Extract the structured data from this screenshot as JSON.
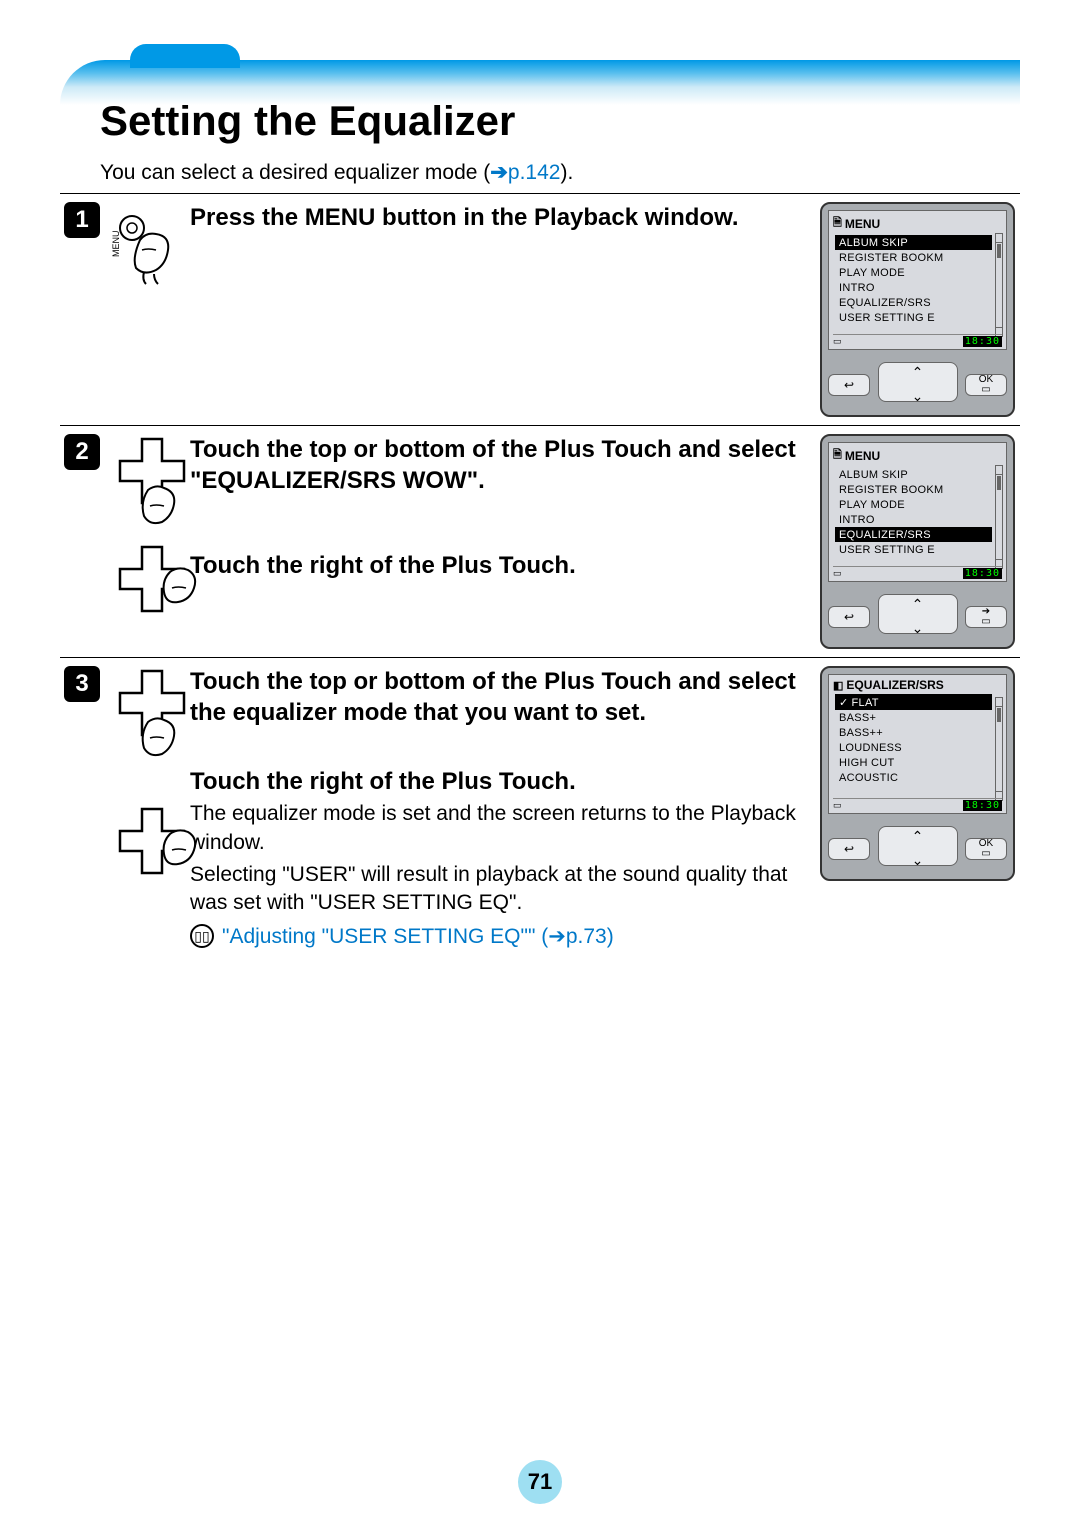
{
  "title": "Setting the Equalizer",
  "intro_text": "You can select a desired equalizer mode (",
  "intro_link_arrow": "➔",
  "intro_link_page": "p.142",
  "intro_close": ").",
  "steps": [
    {
      "num": "1",
      "instruction": "Press the MENU button in the Playback window."
    },
    {
      "num": "2",
      "instruction": "Touch the top or bottom of the Plus Touch and select \"EQUALIZER/SRS WOW\".",
      "sub": "Touch the right of the Plus Touch."
    },
    {
      "num": "3",
      "instruction": "Touch the top or bottom of the Plus Touch and select the equalizer mode that you want to set.",
      "sub": "Touch the right of the Plus Touch.",
      "body1": "The equalizer mode is set and the screen returns to the Playback window.",
      "body2": "Selecting \"USER\" will result in playback at the sound quality that was set with \"USER SETTING EQ\".",
      "ref": "\"Adjusting \"USER SETTING EQ\"\" (➔p.73)"
    }
  ],
  "device1": {
    "title": "MENU",
    "items": [
      "ALBUM SKIP",
      "REGISTER BOOKM",
      "PLAY MODE",
      "INTRO",
      "EQUALIZER/SRS",
      "USER SETTING E"
    ],
    "selected": 0,
    "clock": "18:30",
    "right_btn": "OK"
  },
  "device2": {
    "title": "MENU",
    "items": [
      "ALBUM SKIP",
      "REGISTER BOOKM",
      "PLAY MODE",
      "INTRO",
      "EQUALIZER/SRS",
      "USER SETTING E"
    ],
    "selected": 4,
    "clock": "18:30",
    "right_btn": "➔"
  },
  "device3": {
    "title": "EQUALIZER/SRS",
    "items": [
      "FLAT",
      "BASS+",
      "BASS++",
      "LOUDNESS",
      "HIGH CUT",
      "ACOUSTIC"
    ],
    "selected": 0,
    "check": 0,
    "clock": "18:30",
    "right_btn": "OK"
  },
  "back_btn": "↩",
  "page_number": "71"
}
